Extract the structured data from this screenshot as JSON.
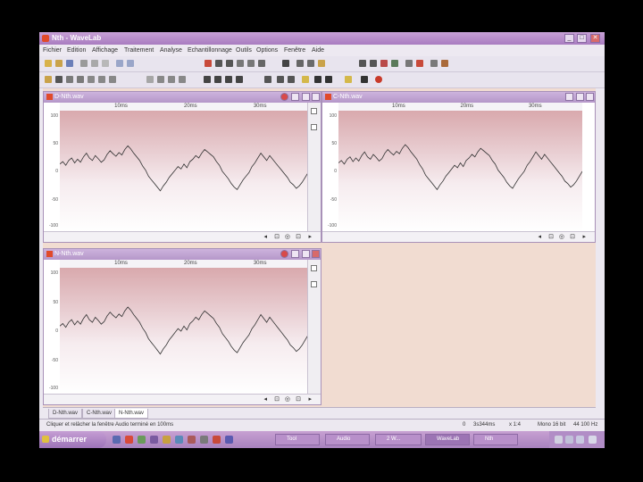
{
  "app": {
    "title": "Nth - WaveLab",
    "window_controls": [
      "_",
      "□",
      "✕"
    ]
  },
  "menu": {
    "items": [
      "Fichier",
      "Edition",
      "Affichage",
      "Traitement",
      "Analyse",
      "Echantillonnage",
      "Outils",
      "Options",
      "Fenêtre",
      "Aide"
    ]
  },
  "windows": [
    {
      "title": "D-Nth.wav",
      "ruler": [
        "10ms",
        "20ms",
        "30ms"
      ],
      "yticks": [
        "100",
        "50",
        "0",
        "-50",
        "-100"
      ],
      "samples": [
        12,
        16,
        10,
        18,
        22,
        14,
        20,
        15,
        24,
        30,
        22,
        18,
        26,
        21,
        15,
        19,
        28,
        34,
        29,
        25,
        31,
        27,
        36,
        42,
        37,
        30,
        24,
        18,
        9,
        2,
        -8,
        -14,
        -20,
        -26,
        -32,
        -24,
        -18,
        -10,
        -4,
        2,
        8,
        4,
        12,
        6,
        16,
        20,
        26,
        22,
        30,
        36,
        32,
        28,
        24,
        16,
        10,
        0,
        -6,
        -12,
        -20,
        -26,
        -30,
        -22,
        -14,
        -8,
        -2,
        8,
        14,
        22,
        30,
        24,
        18,
        26,
        20,
        14,
        8,
        2,
        -4,
        -10,
        -18,
        -22,
        -28,
        -24,
        -18,
        -10,
        -2
      ]
    },
    {
      "title": "C-Nth.wav",
      "ruler": [
        "10ms",
        "20ms",
        "30ms"
      ],
      "yticks": [
        "100",
        "50",
        "0",
        "-50",
        "-100"
      ],
      "samples": [
        14,
        18,
        12,
        20,
        24,
        16,
        22,
        17,
        26,
        32,
        24,
        20,
        28,
        23,
        17,
        21,
        30,
        36,
        31,
        27,
        33,
        29,
        38,
        44,
        39,
        32,
        26,
        20,
        11,
        4,
        -6,
        -12,
        -18,
        -24,
        -30,
        -22,
        -16,
        -8,
        -2,
        4,
        10,
        6,
        14,
        8,
        18,
        22,
        28,
        24,
        32,
        38,
        34,
        30,
        26,
        18,
        12,
        2,
        -4,
        -10,
        -18,
        -24,
        -28,
        -20,
        -12,
        -6,
        0,
        10,
        16,
        24,
        32,
        26,
        20,
        28,
        22,
        16,
        10,
        4,
        -2,
        -8,
        -16,
        -20,
        -26,
        -22,
        -16,
        -8,
        0
      ]
    },
    {
      "title": "N-Nth.wav",
      "ruler": [
        "10ms",
        "20ms",
        "30ms"
      ],
      "yticks": [
        "100",
        "50",
        "0",
        "-50",
        "-100"
      ],
      "samples": [
        8,
        12,
        6,
        14,
        18,
        10,
        16,
        11,
        20,
        26,
        18,
        14,
        22,
        17,
        11,
        15,
        24,
        30,
        25,
        21,
        27,
        23,
        32,
        38,
        33,
        26,
        20,
        14,
        5,
        -2,
        -12,
        -18,
        -24,
        -30,
        -36,
        -28,
        -22,
        -14,
        -8,
        -2,
        4,
        0,
        8,
        2,
        12,
        16,
        22,
        18,
        26,
        32,
        28,
        24,
        20,
        12,
        6,
        -4,
        -10,
        -16,
        -24,
        -30,
        -34,
        -26,
        -18,
        -12,
        -6,
        4,
        10,
        18,
        26,
        20,
        14,
        22,
        16,
        10,
        4,
        -2,
        -8,
        -14,
        -22,
        -26,
        -32,
        -28,
        -22,
        -14,
        -6
      ]
    }
  ],
  "tabs": [
    "D-Nth.wav",
    "C-Nth.wav",
    "N-Nth.wav"
  ],
  "active_tab": 2,
  "status": {
    "message": "Cliquer et relâcher la fenêtre Audio terminé en 100ms",
    "position": "0",
    "duration": "3s344ms",
    "zoom": "x 1:4",
    "format": "Mono 16 bit",
    "rate": "44 100 Hz"
  },
  "taskbar": {
    "start": "démarrer",
    "tasks": [
      "Tool",
      "Audio",
      "2 W...",
      "WaveLab",
      "Nth"
    ]
  },
  "colors": {
    "title": "#b597c9",
    "plot_top": "#d9a9ad",
    "waveform": "#333333",
    "mdi_background": "#f1dcd1"
  }
}
